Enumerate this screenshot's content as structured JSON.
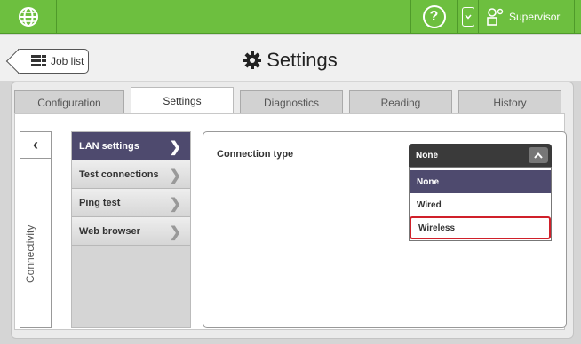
{
  "topbar": {
    "user_label": "Supervisor",
    "icons": [
      "globe-icon",
      "help-icon",
      "chevron-down-icon",
      "user-icon"
    ]
  },
  "header": {
    "job_list_label": "Job list",
    "title": "Settings"
  },
  "tabs": [
    {
      "label": "Configuration",
      "active": false
    },
    {
      "label": "Settings",
      "active": true
    },
    {
      "label": "Diagnostics",
      "active": false
    },
    {
      "label": "Reading",
      "active": false
    },
    {
      "label": "History",
      "active": false
    }
  ],
  "side_rail": {
    "label": "Connectivity"
  },
  "menu": {
    "items": [
      {
        "label": "LAN settings",
        "active": true
      },
      {
        "label": "Test connections",
        "active": false
      },
      {
        "label": "Ping test",
        "active": false
      },
      {
        "label": "Web browser",
        "active": false
      }
    ]
  },
  "connection": {
    "label": "Connection type",
    "selected": "None",
    "options": [
      {
        "label": "None",
        "selected": true
      },
      {
        "label": "Wired",
        "selected": false
      },
      {
        "label": "Wireless",
        "selected": false,
        "highlighted": true
      }
    ]
  },
  "colors": {
    "topbar": "#6dbf3f",
    "accent": "#4e4a6e",
    "highlight": "#d0202a"
  }
}
